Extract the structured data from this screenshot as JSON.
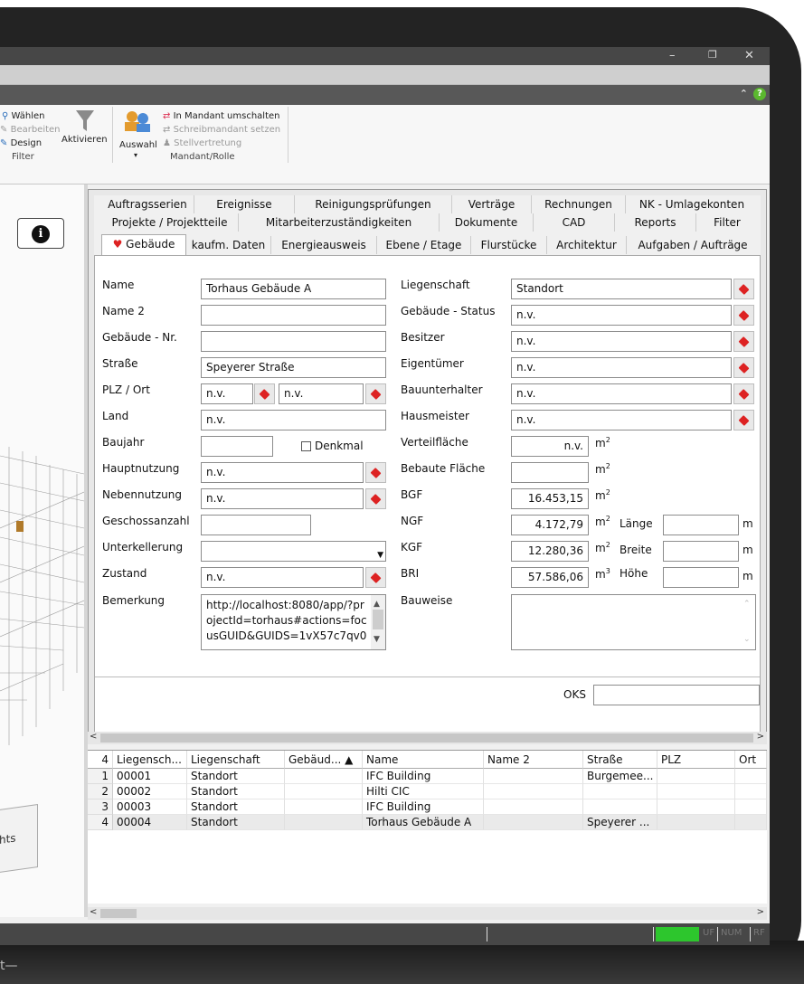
{
  "ribbon": {
    "filter_group": {
      "waehlen": "Wählen",
      "bearbeiten": "Bearbeiten",
      "design": "Design",
      "aktivieren": "Aktivieren",
      "label": "Filter"
    },
    "mandant_group": {
      "auswahl": "Auswahl",
      "in_mandant": "In Mandant umschalten",
      "schreibmandant": "Schreibmandant setzen",
      "stellvertretung": "Stellvertretung",
      "label": "Mandant/Rolle"
    }
  },
  "tabs": {
    "row1": [
      "Auftragsserien",
      "Ereignisse",
      "Reinigungsprüfungen",
      "Verträge",
      "Rechnungen",
      "NK - Umlagekonten"
    ],
    "row2": [
      "Projekte / Projektteile",
      "Mitarbeiterzuständigkeiten",
      "Dokumente",
      "CAD",
      "Reports",
      "Filter"
    ],
    "row3": [
      "Gebäude",
      "kaufm. Daten",
      "Energieausweis",
      "Ebene / Etage",
      "Flurstücke",
      "Architektur",
      "Aufgaben / Aufträge"
    ]
  },
  "form": {
    "left": {
      "name_label": "Name",
      "name_value": "Torhaus Gebäude A",
      "name2_label": "Name 2",
      "name2_value": "",
      "nr_label": "Gebäude - Nr.",
      "nr_value": "",
      "strasse_label": "Straße",
      "strasse_value": "Speyerer Straße",
      "plz_label": "PLZ / Ort",
      "plz_value": "n.v.",
      "ort_value": "n.v.",
      "land_label": "Land",
      "land_value": "n.v.",
      "baujahr_label": "Baujahr",
      "baujahr_value": "",
      "denkmal_label": "Denkmal",
      "hauptnutzung_label": "Hauptnutzung",
      "hauptnutzung_value": "n.v.",
      "nebennutzung_label": "Nebennutzung",
      "nebennutzung_value": "n.v.",
      "geschoss_label": "Geschossanzahl",
      "geschoss_value": "",
      "unterkellerung_label": "Unterkellerung",
      "unterkellerung_value": "",
      "zustand_label": "Zustand",
      "zustand_value": "n.v.",
      "bemerkung_label": "Bemerkung",
      "bemerkung_value": "http://localhost:8080/app/?projectId=torhaus#actions=focusGUID&GUIDS=1vX57c7qv0"
    },
    "right": {
      "liegenschaft_label": "Liegenschaft",
      "liegenschaft_value": "Standort",
      "status_label": "Gebäude - Status",
      "status_value": "n.v.",
      "besitzer_label": "Besitzer",
      "besitzer_value": "n.v.",
      "eigentuemer_label": "Eigentümer",
      "eigentuemer_value": "n.v.",
      "bauunterhalter_label": "Bauunterhalter",
      "bauunterhalter_value": "n.v.",
      "hausmeister_label": "Hausmeister",
      "hausmeister_value": "n.v.",
      "verteil_label": "Verteilfläche",
      "verteil_value": "n.v.",
      "bebaute_label": "Bebaute Fläche",
      "bebaute_value": "",
      "bgf_label": "BGF",
      "bgf_value": "16.453,15",
      "ngf_label": "NGF",
      "ngf_value": "4.172,79",
      "kgf_label": "KGF",
      "kgf_value": "12.280,36",
      "bri_label": "BRI",
      "bri_value": "57.586,06",
      "laenge_label": "Länge",
      "breite_label": "Breite",
      "hoehe_label": "Höhe",
      "laenge_value": "",
      "breite_value": "",
      "hoehe_value": "",
      "unit_m": "m",
      "unit_m2": "m",
      "unit_m3": "m",
      "sup2": "2",
      "sup3": "3",
      "bauweise_label": "Bauweise",
      "bauweise_value": ""
    },
    "oks_label": "OKS",
    "oks_value": ""
  },
  "grid": {
    "count": "4",
    "headers": [
      "Liegensch...",
      "Liegenschaft",
      "Gebäud... ▲",
      "Name",
      "Name 2",
      "Straße",
      "PLZ",
      "Ort"
    ],
    "rows": [
      {
        "n": "1",
        "c": [
          "00001",
          "Standort",
          "",
          "IFC Building",
          "",
          "Burgemee...",
          "",
          ""
        ]
      },
      {
        "n": "2",
        "c": [
          "00002",
          "Standort",
          "",
          "Hilti CIC",
          "",
          "",
          "",
          ""
        ]
      },
      {
        "n": "3",
        "c": [
          "00003",
          "Standort",
          "",
          "IFC Building",
          "",
          "",
          "",
          ""
        ]
      },
      {
        "n": "4",
        "c": [
          "00004",
          "Standort",
          "",
          "Torhaus Gebäude A",
          "",
          "Speyerer ...",
          "",
          ""
        ]
      }
    ]
  },
  "left_pane": {
    "cube_label": "hts"
  },
  "statusbar": {
    "uf": "UF",
    "num": "NUM",
    "rf": "RF"
  },
  "bezel": {
    "logo": "t—"
  }
}
